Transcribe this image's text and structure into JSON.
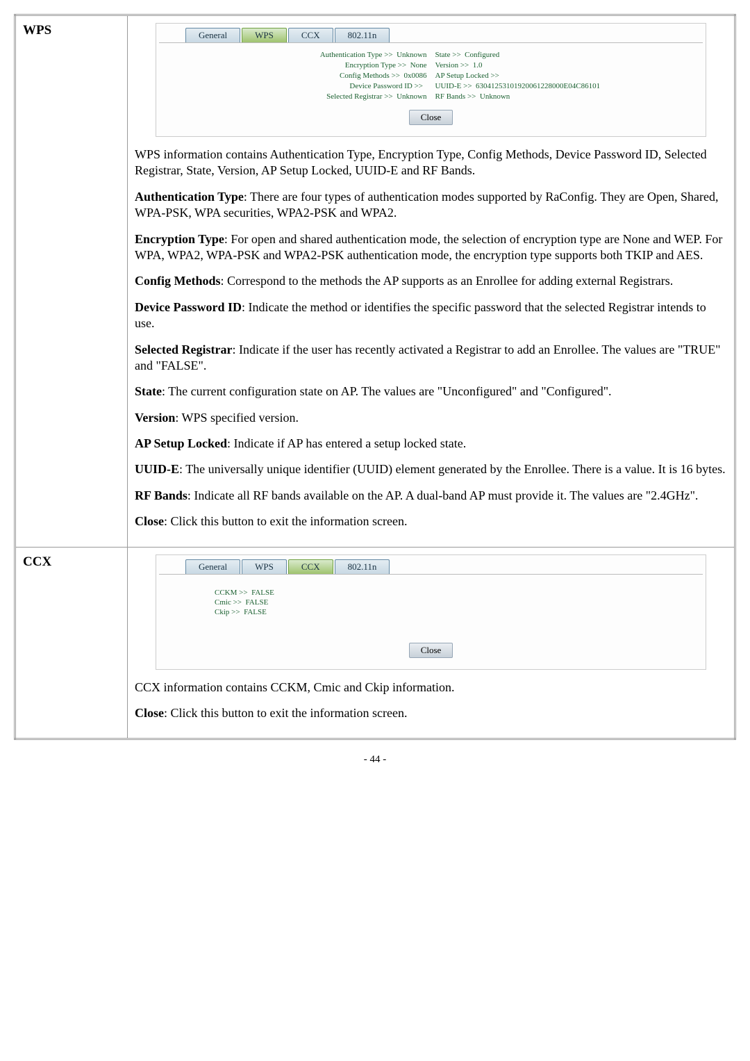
{
  "rows": {
    "wps": {
      "label": "WPS",
      "tabs": {
        "general": "General",
        "wps": "WPS",
        "ccx": "CCX",
        "n": "802.11n"
      },
      "kv": {
        "auth_type_l": "Authentication Type >>",
        "auth_type_r": "Unknown",
        "state_l": "State >>",
        "state_r": "Configured",
        "enc_type_l": "Encryption Type >>",
        "enc_type_r": "None",
        "version_l": "Version >>",
        "version_r": "1.0",
        "cfg_l": "Config Methods >>",
        "cfg_r": "0x0086",
        "aplock_l": "AP Setup Locked >>",
        "aplock_r": "",
        "devpw_l": "Device Password ID >>",
        "devpw_r": "",
        "uuid_l": "UUID-E >>",
        "uuid_r": "63041253101920061228000E04C86101",
        "selreg_l": "Selected Registrar >>",
        "selreg_r": "Unknown",
        "rf_l": "RF Bands >>",
        "rf_r": "Unknown"
      },
      "close": "Close",
      "paragraphs": {
        "intro": "WPS information contains Authentication Type, Encryption Type, Config Methods, Device Password ID, Selected Registrar, State, Version, AP Setup Locked, UUID-E and RF Bands.",
        "auth_b": "Authentication Type",
        "auth_t": ": There are four types of authentication modes supported by RaConfig. They are Open, Shared, WPA-PSK, WPA securities, WPA2-PSK and WPA2.",
        "enc_b": "Encryption Type",
        "enc_t": ": For open and shared authentication mode, the selection of encryption type are None and WEP. For WPA, WPA2, WPA-PSK and WPA2-PSK authentication mode, the encryption type supports both TKIP and AES.",
        "cfg_b": "Config Methods",
        "cfg_t": ": Correspond to the methods the AP supports as an Enrollee for adding external Registrars.",
        "devpw_b": "Device Password ID",
        "devpw_t": ": Indicate the method or identifies the specific password that the selected Registrar intends to use.",
        "selreg_b": "Selected Registrar",
        "selreg_t": ": Indicate if the user has recently activated a Registrar to add an Enrollee. The values are \"TRUE\" and \"FALSE\".",
        "state_b": "State",
        "state_t": ": The current configuration state on AP. The values are \"Unconfigured\" and \"Configured\".",
        "ver_b": "Version",
        "ver_t": ": WPS specified version.",
        "aplock_b": "AP Setup Locked",
        "aplock_t": ": Indicate if AP has entered a setup locked state.",
        "uuid_b": "UUID-E",
        "uuid_t": ": The universally unique identifier (UUID) element generated by the Enrollee. There is a value. It is 16 bytes.",
        "rf_b": "RF Bands",
        "rf_t": ": Indicate all RF bands available on the AP. A dual-band AP must provide it. The values are \"2.4GHz\".",
        "close_b": "Close",
        "close_t": ": Click this button to exit the information screen."
      }
    },
    "ccx": {
      "label": "CCX",
      "kv": {
        "cckm_l": "CCKM >>",
        "cckm_r": "FALSE",
        "cmic_l": "Cmic >>",
        "cmic_r": "FALSE",
        "ckip_l": "Ckip >>",
        "ckip_r": "FALSE"
      },
      "close": "Close",
      "paragraphs": {
        "intro": "CCX information contains CCKM, Cmic and Ckip information.",
        "close_b": "Close",
        "close_t": ": Click this button to exit the information screen."
      }
    }
  },
  "footer": "- 44 -"
}
